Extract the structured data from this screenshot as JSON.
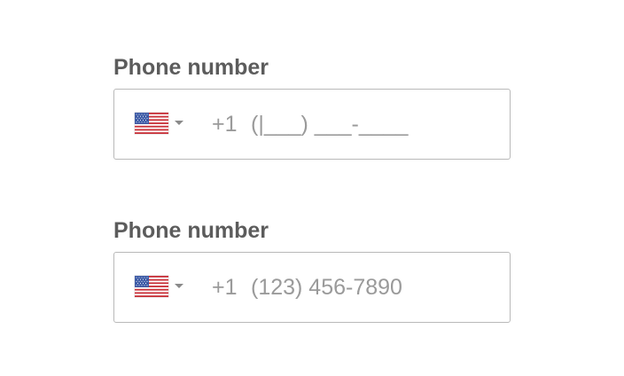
{
  "fields": [
    {
      "label": "Phone number",
      "country_icon": "us-flag-icon",
      "dial_code": "+1",
      "value": "",
      "mask": "(|___) ___-____"
    },
    {
      "label": "Phone number",
      "country_icon": "us-flag-icon",
      "dial_code": "+1",
      "value": "",
      "placeholder": "(123) 456-7890"
    }
  ],
  "colors": {
    "label": "#5c5c5c",
    "text_muted": "#9a9a9a",
    "border": "#b9b9b9",
    "flag_red": "#c8323a",
    "flag_blue": "#3c5aa6"
  }
}
